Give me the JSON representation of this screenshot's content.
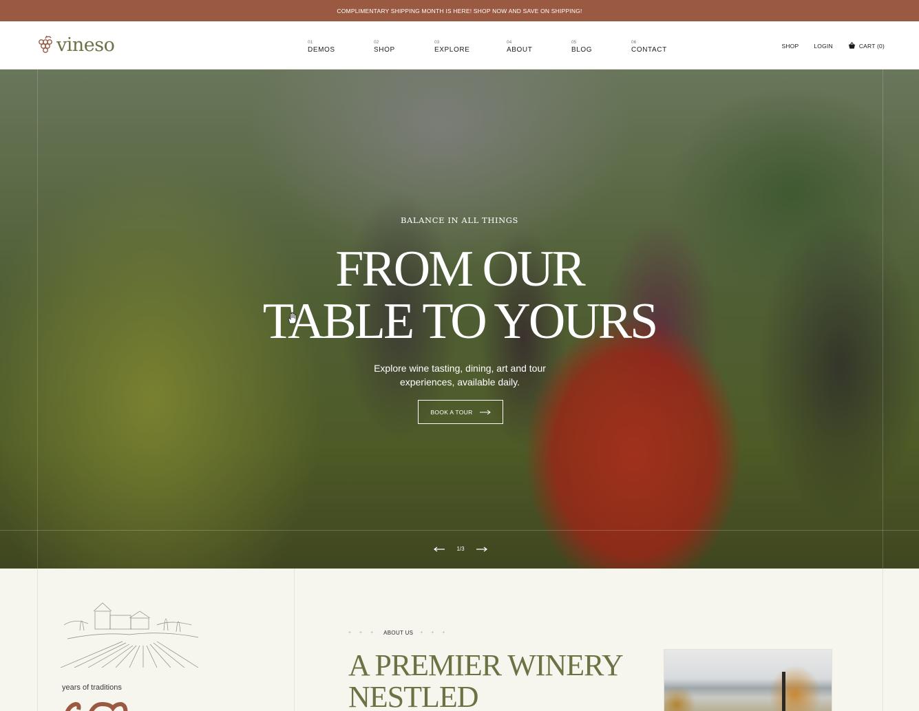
{
  "promo": {
    "text": "COMPLIMENTARY SHIPPING MONTH IS HERE! SHOP NOW AND SAVE ON SHIPPING!"
  },
  "logo": {
    "text": "vineso",
    "icon": "grape-icon"
  },
  "nav": [
    {
      "num": "01",
      "label": "DEMOS"
    },
    {
      "num": "02",
      "label": "SHOP"
    },
    {
      "num": "03",
      "label": "EXPLORE"
    },
    {
      "num": "04",
      "label": "ABOUT"
    },
    {
      "num": "05",
      "label": "BLOG"
    },
    {
      "num": "06",
      "label": "CONTACT"
    }
  ],
  "header_right": {
    "shop": "SHOP",
    "login": "LOGIN",
    "cart": "CART (0)"
  },
  "hero": {
    "eyebrow": "BALANCE IN ALL THINGS",
    "title_line1": "FROM OUR",
    "title_line2": "TABLE TO YOURS",
    "subtitle": "Explore wine tasting, dining, art and tour experiences, available daily.",
    "button": "BOOK A TOUR",
    "slide_counter": "1/3"
  },
  "about": {
    "years_label": "years of traditions",
    "eyebrow": "ABOUT US",
    "stars": "+ + +",
    "title": "A PREMIER WINERY NESTLED"
  },
  "colors": {
    "promo_bg": "#9a5a42",
    "brand_olive": "#6b7244",
    "accent_brown": "#9a5a42",
    "section_bg": "#f6f5ee"
  }
}
